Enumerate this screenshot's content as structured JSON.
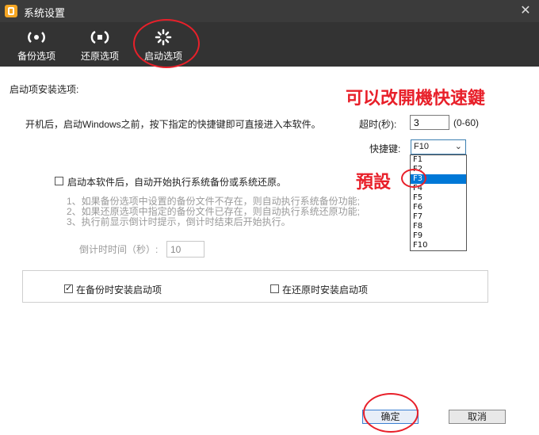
{
  "window": {
    "title": "系统设置",
    "close_glyph": "✕"
  },
  "toolbar": {
    "items": [
      {
        "label": "备份选项",
        "icon": "backup-icon"
      },
      {
        "label": "还原选项",
        "icon": "restore-icon"
      },
      {
        "label": "启动选项",
        "icon": "startup-icon",
        "selected": true
      }
    ]
  },
  "main": {
    "section_title": "启动项安装选项:",
    "description": "开机后，启动Windows之前，按下指定的快捷键即可直接进入本软件。",
    "timeout": {
      "label": "超时(秒):",
      "value": "3",
      "range": "(0-60)"
    },
    "hotkey": {
      "label": "快捷键:",
      "selected": "F10",
      "options": [
        "F1",
        "F2",
        "F3",
        "F4",
        "F5",
        "F6",
        "F7",
        "F8",
        "F9",
        "F10"
      ],
      "highlighted": "F3"
    },
    "auto_start": {
      "label": "启动本软件后，自动开始执行系统备份或系统还原。",
      "checked": false,
      "notes": [
        "1、如果备份选项中设置的备份文件不存在，则自动执行系统备份功能;",
        "2、如果还原选项中指定的备份文件已存在，则自动执行系统还原功能;",
        "3、执行前显示倒计时提示，倒计时结束后开始执行。"
      ],
      "countdown_label": "倒计时时间（秒）:",
      "countdown_value": "10"
    },
    "install_options": {
      "on_backup": {
        "label": "在备份时安装启动项",
        "checked": true
      },
      "on_restore": {
        "label": "在还原时安装启动项",
        "checked": false
      }
    }
  },
  "annotations": {
    "hotkey_note": "可以改開機快速鍵",
    "default_note": "預設"
  },
  "footer": {
    "ok_label": "确定",
    "cancel_label": "取消"
  },
  "colors": {
    "annotation": "#e8202a",
    "titlebar": "#3b3b3b",
    "toolbar": "#333333",
    "selection": "#0078d7"
  }
}
